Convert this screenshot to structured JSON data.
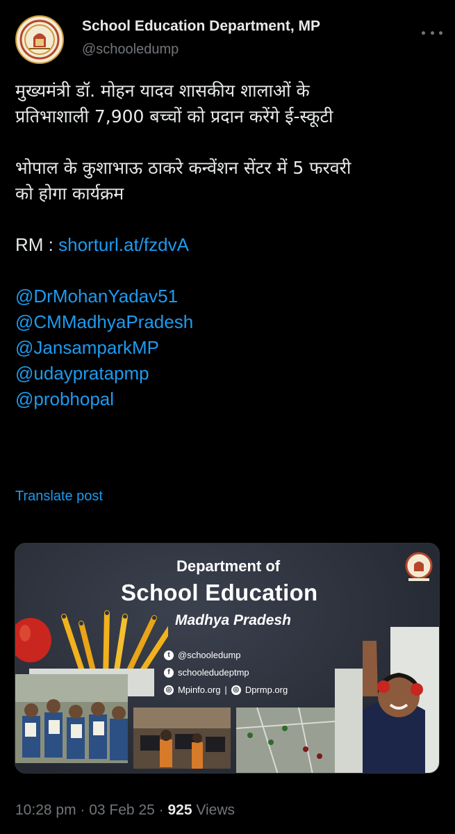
{
  "account": {
    "display_name": "School Education Department, MP",
    "handle": "@schooledump",
    "avatar_icon": "government-emblem-logo"
  },
  "post": {
    "para1_line1": "मुख्यमंत्री डॉ. मोहन यादव शासकीय शालाओं के",
    "para1_line2": "प्रतिभाशाली 7,900 बच्चों को प्रदान करेंगे ई-स्कूटी",
    "para2_line1": "भोपाल के कुशाभाऊ ठाकरे कन्वेंशन सेंटर में 5 फरवरी",
    "para2_line2": "को होगा कार्यक्रम",
    "rm_label": "RM : ",
    "rm_link": "shorturl.at/fzdvA",
    "mentions": [
      "@DrMohanYadav51",
      "@CMMadhyaPradesh",
      "@JansamparkMP",
      "@udaypratapmp",
      "@probhopal"
    ]
  },
  "translate_label": "Translate post",
  "media": {
    "title_line1": "Department of",
    "title_line2": "School Education",
    "title_line3": "Madhya Pradesh",
    "social_twitter": "@schooledump",
    "social_facebook": "schooledudeptmp",
    "social_web1": "Mpinfo.org",
    "social_separator": "|",
    "social_web2": "Dprmp.org"
  },
  "meta": {
    "time": "10:28 pm",
    "separator": " · ",
    "date": "03 Feb 25",
    "views_count": "925",
    "views_label": " Views"
  },
  "colors": {
    "background": "#000000",
    "text": "#e7e9ea",
    "muted": "#71767b",
    "link": "#1d9bf0"
  }
}
